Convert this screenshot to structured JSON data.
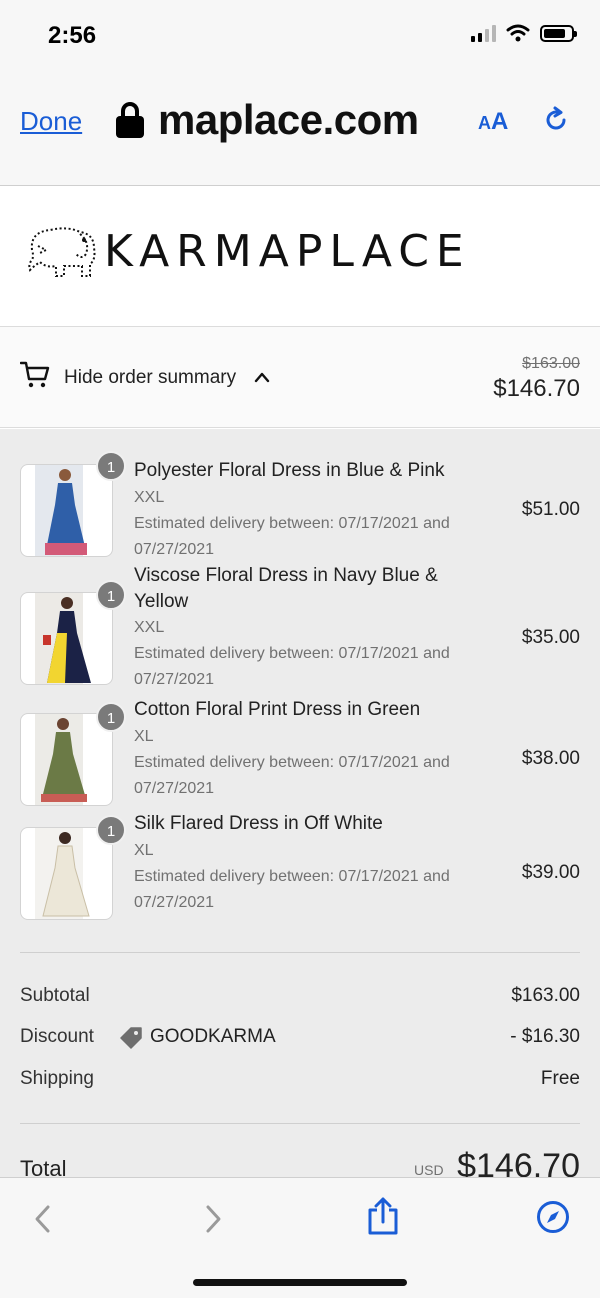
{
  "status": {
    "time": "2:56"
  },
  "browser": {
    "done_label": "Done",
    "url": "maplace.com",
    "aa_small": "A",
    "aa_big": "A",
    "icons": [
      "lock-icon",
      "reload-icon",
      "back-icon",
      "forward-icon",
      "share-icon",
      "compass-icon"
    ]
  },
  "brand": {
    "name": "KARMAPLACE"
  },
  "summary": {
    "toggle_label": "Hide order summary",
    "original_total": "$163.00",
    "total": "$146.70"
  },
  "items": [
    {
      "qty": "1",
      "title": "Polyester Floral Dress in Blue & Pink",
      "variant": "XXL",
      "delivery": "Estimated delivery between: 07/17/2021 and 07/27/2021",
      "price": "$51.00",
      "colors": [
        "#2f5fa8",
        "#d35a78"
      ]
    },
    {
      "qty": "1",
      "title": "Viscose Floral Dress in Navy Blue & Yellow",
      "variant": "XXL",
      "delivery": "Estimated delivery between: 07/17/2021 and 07/27/2021",
      "price": "$35.00",
      "colors": [
        "#1b2246",
        "#f2d530"
      ]
    },
    {
      "qty": "1",
      "title": "Cotton Floral Print Dress in Green",
      "variant": "XL",
      "delivery": "Estimated delivery between: 07/17/2021 and 07/27/2021",
      "price": "$38.00",
      "colors": [
        "#6b7a46",
        "#c85d55"
      ]
    },
    {
      "qty": "1",
      "title": "Silk Flared Dress in Off White",
      "variant": "XL",
      "delivery": "Estimated delivery between: 07/17/2021 and 07/27/2021",
      "price": "$39.00",
      "colors": [
        "#ece7d8",
        "#c9bfa6"
      ]
    }
  ],
  "totals": {
    "subtotal_label": "Subtotal",
    "subtotal": "$163.00",
    "discount_label": "Discount",
    "discount_code": "GOODKARMA",
    "discount": "- $16.30",
    "shipping_label": "Shipping",
    "shipping": "Free",
    "total_label": "Total",
    "currency": "USD",
    "total": "$146.70"
  },
  "colors": {
    "link": "#1a5dd6",
    "summary_bg": "#ececec"
  }
}
